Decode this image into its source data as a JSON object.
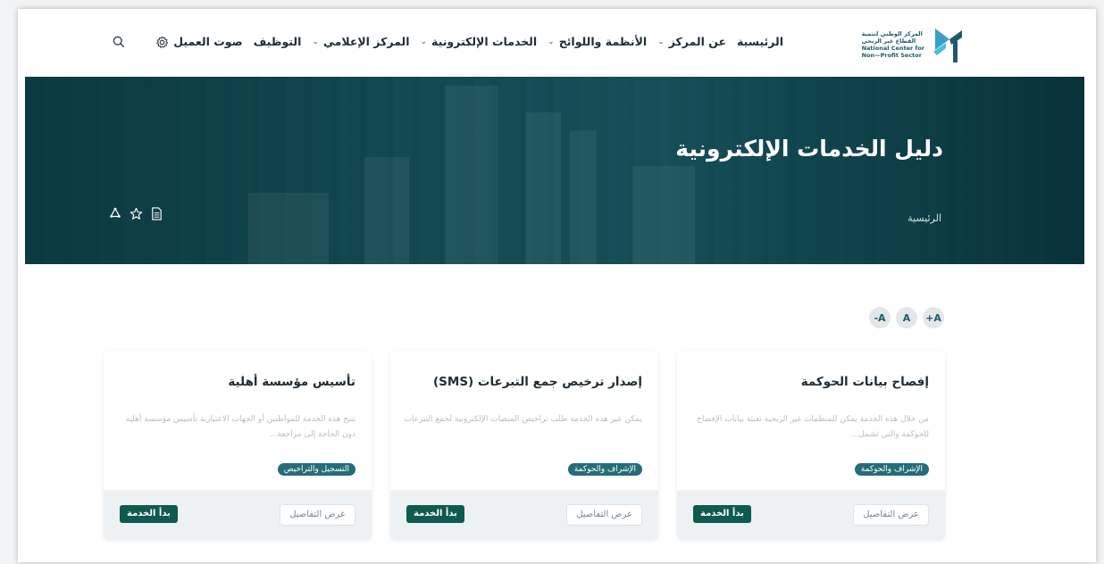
{
  "logo": {
    "ar_line1": "المركز الوطني لتنمية",
    "ar_line2": "القطاع غير الربحي",
    "en_line1": "National Center for",
    "en_line2": "Non—Profit Sector"
  },
  "nav": {
    "items": [
      {
        "label": "الرئيسية",
        "has_dropdown": false
      },
      {
        "label": "عن المركز",
        "has_dropdown": true
      },
      {
        "label": "الأنظمة واللوائح",
        "has_dropdown": true
      },
      {
        "label": "الخدمات الإلكترونية",
        "has_dropdown": true
      },
      {
        "label": "المركز الإعلامي",
        "has_dropdown": true
      },
      {
        "label": "التوظيف",
        "has_dropdown": false
      },
      {
        "label": "صوت العميل",
        "has_dropdown": false
      }
    ],
    "chevron": "⌄",
    "settings_icon": "gear-icon",
    "search_icon": "search-icon"
  },
  "hero": {
    "title": "دليل الخدمات الإلكترونية",
    "breadcrumb": "الرئيسية",
    "actions": [
      "document-icon",
      "star-icon",
      "share-icon"
    ]
  },
  "font_controls": [
    "A+",
    "A",
    "A-"
  ],
  "cards": [
    {
      "title": "إفصاح بيانات الحوكمة",
      "description": "من خلال هذه الخدمة يمكن للمنظمات غير الربحية تعبئة بيانات الإفصاح للحوكمة والتي تشمل...",
      "tag": "الإشراف والحوكمة",
      "details_label": "عرض التفاصيل",
      "start_label": "بدأ الخدمة"
    },
    {
      "title": "إصدار ترخيص جمع التبرعات (SMS)",
      "description": "يمكن عبر هذه الخدمة طلب تراخيص المنصات الإلكترونية لجمع التبرعات",
      "tag": "الإشراف والحوكمة",
      "details_label": "عرض التفاصيل",
      "start_label": "بدأ الخدمة"
    },
    {
      "title": "تأسيس مؤسسة أهلية",
      "description": "تتيح هذه الخدمة للمواطنين أو الجهات الاعتبارية تأسيس مؤسسة أهلية دون الحاجة إلى مراجعة...",
      "tag": "التسجيل والتراخيص",
      "details_label": "عرض التفاصيل",
      "start_label": "بدأ الخدمة"
    }
  ],
  "colors": {
    "brand_teal": "#256c7a",
    "start_button": "#0f5a4e",
    "hero_overlay": "#0a373e"
  }
}
